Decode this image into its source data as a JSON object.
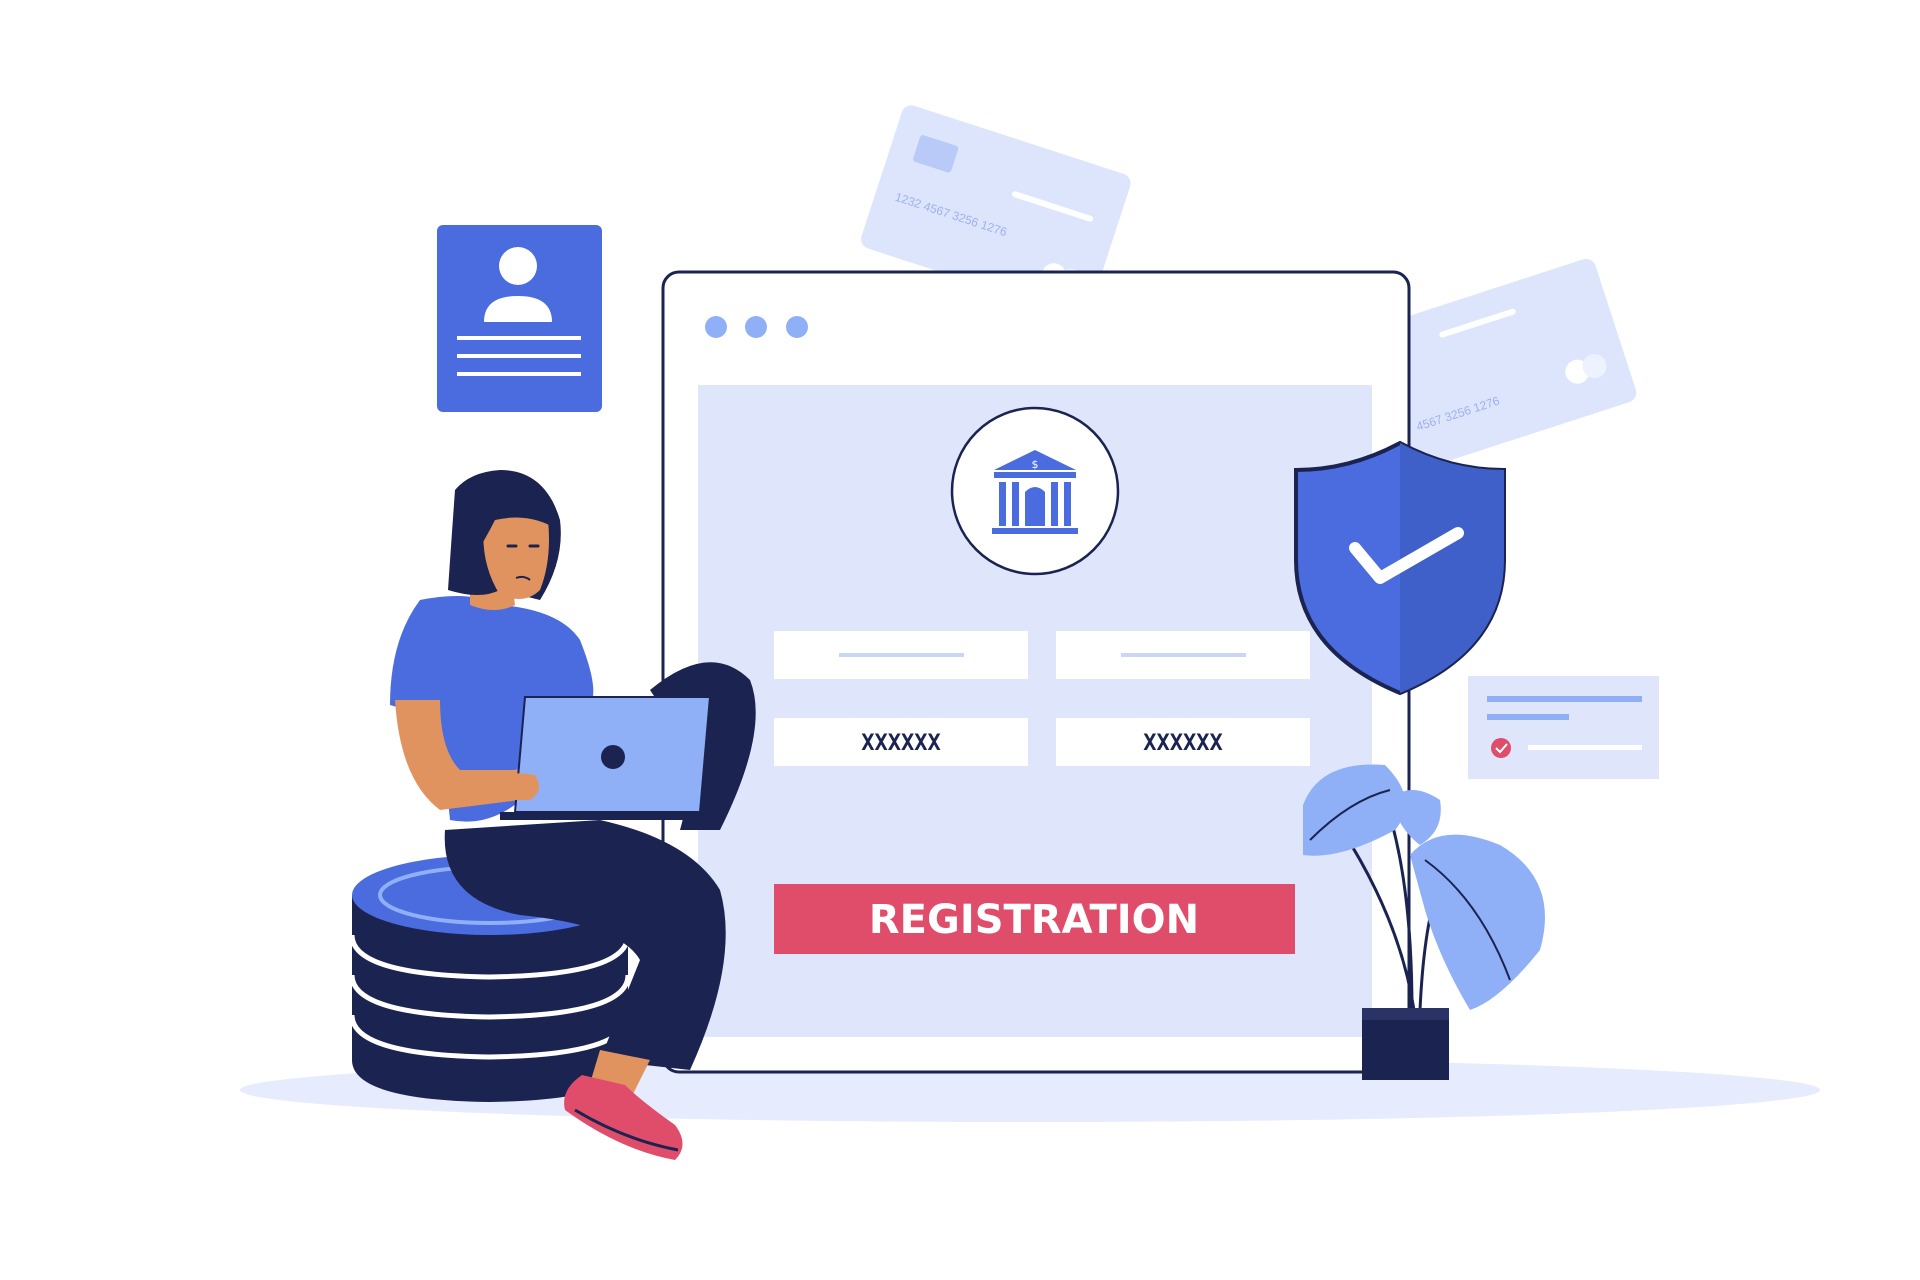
{
  "form": {
    "field_left_masked": "XXXXXX",
    "field_right_masked": "XXXXXX",
    "button_label": "REGISTRATION"
  },
  "cards": {
    "card_back_number": "1232 4567 3256 1276",
    "card_front_number": "4567 3256 1276"
  },
  "icons": {
    "bank": "bank-icon",
    "shield": "shield-check-icon",
    "profile": "profile-card-icon",
    "check": "check-icon"
  },
  "colors": {
    "navy": "#1b2350",
    "blue": "#4b6cde",
    "light_blue": "#dfe6fc",
    "accent_red": "#df4d6a",
    "pale_blue": "#c9d6fa",
    "skin": "#e0935f"
  }
}
